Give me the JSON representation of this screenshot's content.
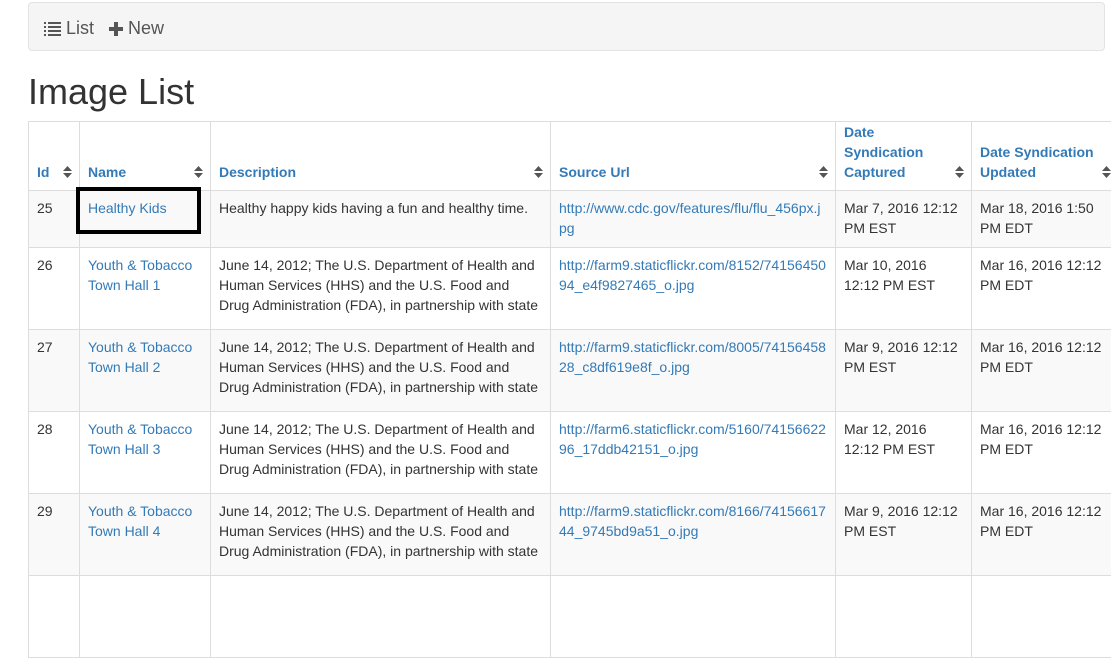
{
  "toolbar": {
    "list_label": "List",
    "new_label": "New"
  },
  "page": {
    "title": "Image List"
  },
  "table": {
    "columns": [
      "Id",
      "Name",
      "Description",
      "Source Url",
      "Date Syndication Captured",
      "Date Syndication Updated"
    ],
    "rows": [
      {
        "id": "25",
        "name": "Healthy Kids",
        "description": "Healthy happy kids having a fun and healthy time.",
        "source_url": "http://www.cdc.gov/features/flu/flu_456px.jpg",
        "captured": "Mar 7, 2016 12:12 PM EST",
        "updated": "Mar 18, 2016 1:50 PM EDT"
      },
      {
        "id": "26",
        "name": "Youth & Tobacco Town Hall 1",
        "description": "June 14, 2012; The U.S. Department of Health and Human Services (HHS) and the U.S. Food and Drug Administration (FDA), in partnership with state and",
        "source_url": "http://farm9.staticflickr.com/8152/7415645094_e4f9827465_o.jpg",
        "captured": "Mar 10, 2016 12:12 PM EST",
        "updated": "Mar 16, 2016 12:12 PM EDT"
      },
      {
        "id": "27",
        "name": "Youth & Tobacco Town Hall 2",
        "description": "June 14, 2012; The U.S. Department of Health and Human Services (HHS) and the U.S. Food and Drug Administration (FDA), in partnership with state and",
        "source_url": "http://farm9.staticflickr.com/8005/7415645828_c8df619e8f_o.jpg",
        "captured": "Mar 9, 2016 12:12 PM EST",
        "updated": "Mar 16, 2016 12:12 PM EDT"
      },
      {
        "id": "28",
        "name": "Youth & Tobacco Town Hall 3",
        "description": "June 14, 2012; The U.S. Department of Health and Human Services (HHS) and the U.S. Food and Drug Administration (FDA), in partnership with state and",
        "source_url": "http://farm6.staticflickr.com/5160/7415662296_17ddb42151_o.jpg",
        "captured": "Mar 12, 2016 12:12 PM EST",
        "updated": "Mar 16, 2016 12:12 PM EDT"
      },
      {
        "id": "29",
        "name": "Youth & Tobacco Town Hall 4",
        "description": "June 14, 2012; The U.S. Department of Health and Human Services (HHS) and the U.S. Food and Drug Administration (FDA), in partnership with state and",
        "source_url": "http://farm9.staticflickr.com/8166/7415661744_9745bd9a51_o.jpg",
        "captured": "Mar 9, 2016 12:12 PM EST",
        "updated": "Mar 16, 2016 12:12 PM EDT"
      }
    ]
  },
  "colors": {
    "link": "#337ab7",
    "stripe": "#f9f9f9",
    "border": "#dddddd"
  }
}
